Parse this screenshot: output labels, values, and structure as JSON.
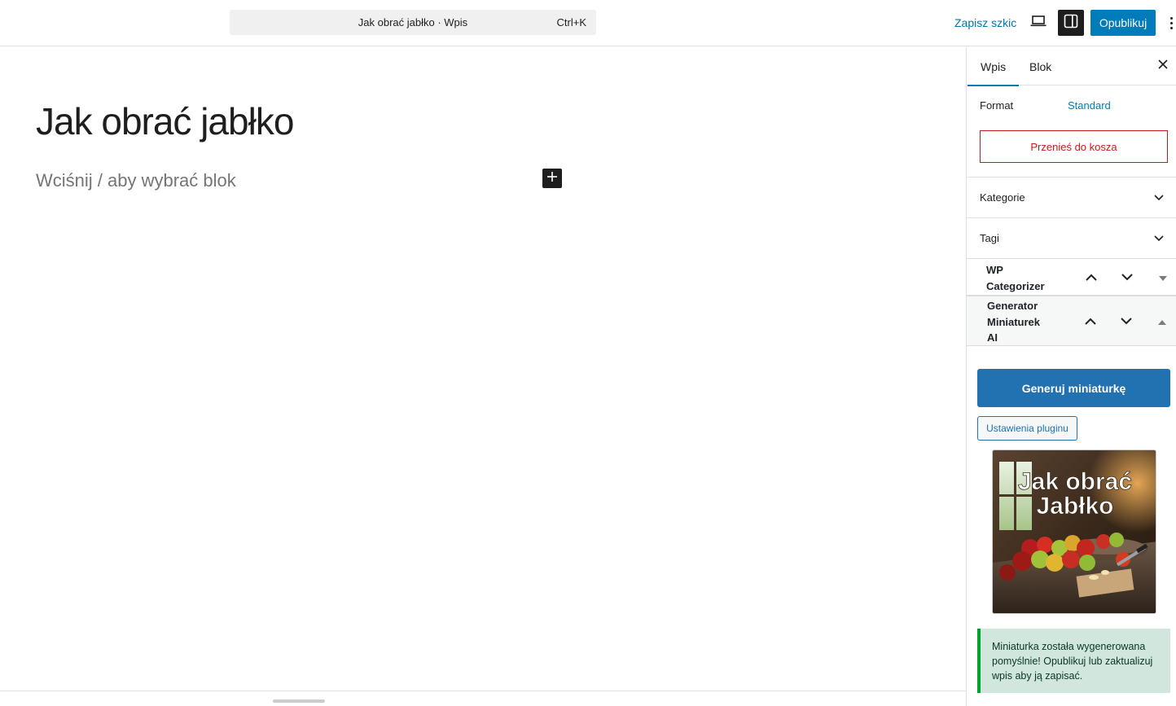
{
  "topbar": {
    "command_title": "Jak obrać jabłko · Wpis",
    "command_shortcut": "Ctrl+K",
    "save_draft": "Zapisz szkic",
    "preview_icon": "laptop-icon",
    "settings_icon": "sidebar-toggle-icon",
    "publish": "Opublikuj",
    "more_icon": "more-vertical-icon"
  },
  "editor": {
    "title": "Jak obrać jabłko",
    "placeholder": "Wciśnij / aby wybrać blok",
    "inserter_icon": "plus-icon"
  },
  "sidebar": {
    "tabs": [
      "Wpis",
      "Blok"
    ],
    "close_icon": "close-icon",
    "format_label": "Format",
    "format_value": "Standard",
    "trash_label": "Przenieś do kosza",
    "panels": [
      {
        "label": "Kategorie"
      },
      {
        "label": "Tagi"
      }
    ],
    "metaboxes": [
      {
        "title_lines": [
          "WP",
          "Categorizer"
        ],
        "toggle": "collapsed"
      },
      {
        "title_lines": [
          "Generator",
          "Miniaturek",
          "AI"
        ],
        "toggle": "expanded"
      }
    ],
    "plugin": {
      "generate_label": "Generuj miniaturkę",
      "settings_label": "Ustawienia pluginu",
      "thumbnail_text_lines": [
        "Jak obrać",
        "Jabłko"
      ],
      "notice": "Miniaturka została wygenerowana pomyślnie! Opublikuj lub zaktualizuj wpis aby ją zapisać."
    }
  },
  "colors": {
    "accent": "#007cba",
    "plugin_button": "#2271b1",
    "danger": "#cc1818",
    "notice_bg": "#d1e7dd",
    "notice_border": "#00a32a"
  }
}
